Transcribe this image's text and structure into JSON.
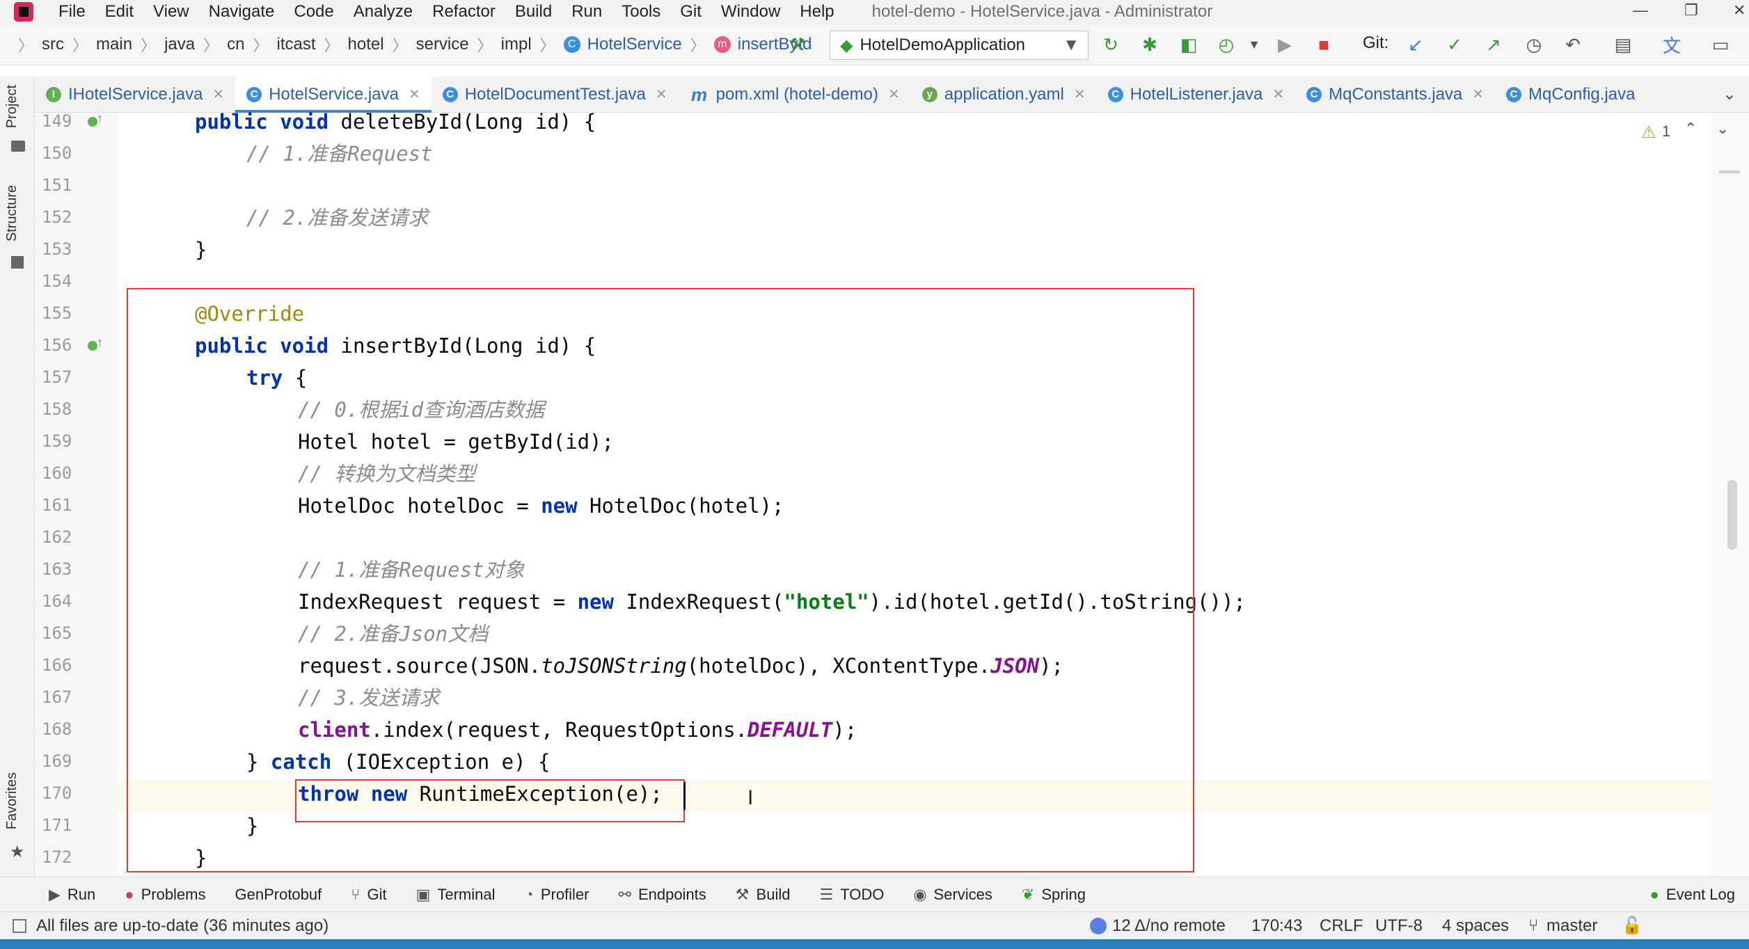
{
  "menu": {
    "items": [
      "File",
      "Edit",
      "View",
      "Navigate",
      "Code",
      "Analyze",
      "Refactor",
      "Build",
      "Run",
      "Tools",
      "Git",
      "Window",
      "Help"
    ],
    "window_title": "hotel-demo - HotelService.java - Administrator"
  },
  "breadcrumb": {
    "items": [
      "src",
      "main",
      "java",
      "cn",
      "itcast",
      "hotel",
      "service",
      "impl"
    ],
    "class_name": "HotelService",
    "method_name": "insertById"
  },
  "toolbar": {
    "run_config": "HotelDemoApplication",
    "git_label": "Git:"
  },
  "tabs": [
    {
      "label": "IHotelService.java",
      "icon": "I"
    },
    {
      "label": "HotelService.java",
      "icon": "C"
    },
    {
      "label": "HotelDocumentTest.java",
      "icon": "C"
    },
    {
      "label": "pom.xml (hotel-demo)",
      "icon": "m"
    },
    {
      "label": "application.yaml",
      "icon": "y"
    },
    {
      "label": "HotelListener.java",
      "icon": "C"
    },
    {
      "label": "MqConstants.java",
      "icon": "C"
    },
    {
      "label": "MqConfig.java",
      "icon": "C"
    }
  ],
  "left_strip": {
    "project": "Project",
    "structure": "Structure",
    "favorites": "Favorites"
  },
  "editor": {
    "warning_count": "1",
    "line_numbers": [
      "149",
      "150",
      "151",
      "152",
      "153",
      "154",
      "155",
      "156",
      "157",
      "158",
      "159",
      "160",
      "161",
      "162",
      "163",
      "164",
      "165",
      "166",
      "167",
      "168",
      "169",
      "170",
      "171",
      "172"
    ],
    "code": {
      "l149_kw": "public void",
      "l149_rest": " deleteById(Long id) {",
      "l150": "// 1.准备Request",
      "l152": "// 2.准备发送请求",
      "l153": "}",
      "l155": "@Override",
      "l156_kw": "public void",
      "l156_rest": " insertById(Long id) {",
      "l157_kw": "try",
      "l157_rest": " {",
      "l158": "// 0.根据id查询酒店数据",
      "l159": "Hotel hotel = getById(id);",
      "l160": "// 转换为文档类型",
      "l161_a": "HotelDoc hotelDoc = ",
      "l161_kw": "new",
      "l161_b": " HotelDoc(hotel);",
      "l163": "// 1.准备Request对象",
      "l164_a": "IndexRequest request = ",
      "l164_kw": "new",
      "l164_b": " IndexRequest(",
      "l164_str": "\"hotel\"",
      "l164_c": ").id(hotel.getId().toString());",
      "l165": "// 2.准备Json文档",
      "l166_a": "request.source(JSON.",
      "l166_it": "toJSONString",
      "l166_b": "(hotelDoc), XContentType.",
      "l166_cst": "JSON",
      "l166_c": ");",
      "l167": "// 3.发送请求",
      "l168_fld": "client",
      "l168_a": ".index(request, RequestOptions.",
      "l168_cst": "DEFAULT",
      "l168_b": ");",
      "l169_a": "} ",
      "l169_kw": "catch",
      "l169_b": " (IOException e) {",
      "l170_kw1": "throw",
      "l170_kw2": "new",
      "l170_rest": " RuntimeException(e);",
      "l171": "}",
      "l172": "}"
    }
  },
  "bottom_tools": [
    "Run",
    "Problems",
    "GenProtobuf",
    "Git",
    "Terminal",
    "Profiler",
    "Endpoints",
    "Build",
    "TODO",
    "Services",
    "Spring"
  ],
  "event_log": "Event Log",
  "status": {
    "message": "All files are up-to-date (36 minutes ago)",
    "git_remote": "12 Δ/no remote",
    "position": "170:43",
    "line_sep": "CRLF",
    "encoding": "UTF-8",
    "indent": "4 spaces",
    "branch": "master"
  },
  "colors": {
    "keyword": "#0033b3",
    "comment": "#8c8c8c",
    "annotation": "#9e880d",
    "string": "#067d17",
    "field": "#871094",
    "highlight_box": "#e53935"
  }
}
